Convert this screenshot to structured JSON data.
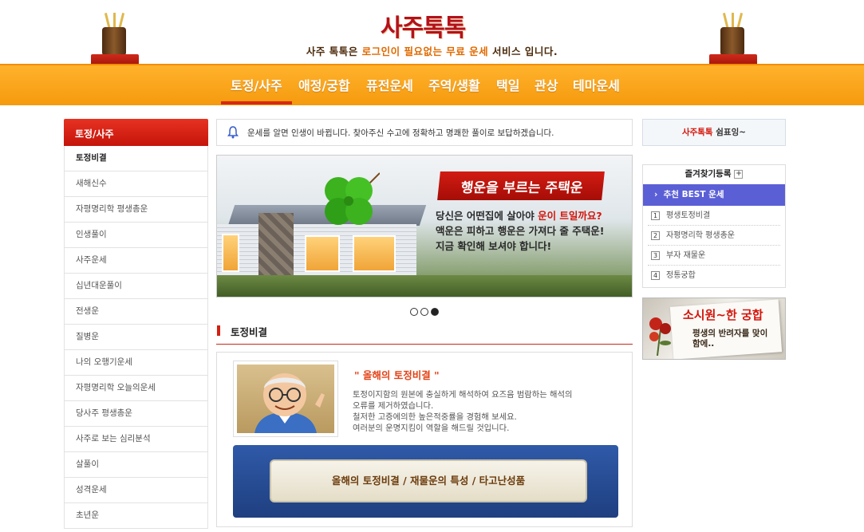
{
  "header": {
    "logo": "사주톡톡",
    "tagline_pre": "사주 톡톡은 ",
    "tagline_hl": "로그인이 필요없는 무료 운세",
    "tagline_post": " 서비스 입니다.",
    "nav": [
      "토정/사주",
      "애정/궁합",
      "퓨전운세",
      "주역/생활",
      "택일",
      "관상",
      "테마운세"
    ],
    "active_nav": "토정/사주"
  },
  "sidebar": {
    "title": "토정/사주",
    "items": [
      "토정비결",
      "새해신수",
      "자평명리학 평생총운",
      "인생풀이",
      "사주운세",
      "십년대운풀이",
      "전생운",
      "질병운",
      "나의 오행기운세",
      "자평명리학 오늘의운세",
      "당사주 평생총운",
      "사주로 보는 심리분석",
      "살풀이",
      "성격운세",
      "초년운"
    ]
  },
  "notice": {
    "text": "운세를 알면 인생이 바뀝니다. 찾아주신 수고에 정확하고 명쾌한 풀이로 보답하겠습니다."
  },
  "banner": {
    "ribbon": "행운을 부르는 주택운",
    "line1_pre": "당신은 어떤집에 살아야 ",
    "line1_hl": "운이 트일까요?",
    "line2": "액운은 피하고 행운은 가져다 줄 주택운!",
    "line3": "지금 확인해 보셔야 합니다!",
    "slides": 3,
    "active_slide": 3
  },
  "section": {
    "title": "토정비결",
    "heading": "\" 올해의 토정비결 \"",
    "desc": [
      "토정이지함의 원본에 충실하게 해석하여 요즈음 범람하는 해석의",
      "오류를 제거하였습니다.",
      "철저한 고증에의한 높은적중률을 경험해 보세요.",
      "여러분의 운명지킴이 역할을 해드릴 것입니다."
    ],
    "scroll_text": "올해의 토정비결 / 재물운의 특성 / 타고난성품"
  },
  "right": {
    "welcome_brand": "사주톡톡",
    "welcome_rest": " 쉼표잉~",
    "fav_title": "즐겨찾기등록",
    "fav_plus": "+",
    "best_label": "추천 BEST 운세",
    "best_items": [
      "평생토정비결",
      "자평명리학 평생총운",
      "부자 재물운",
      "정통궁합"
    ],
    "ad_title": "소시원~한 궁합",
    "ad_sub": "평생의 반려자를 맞이함에.."
  },
  "colors": {
    "accent": "#f59a0e",
    "red": "#d3160c",
    "best": "#5b5fd6"
  }
}
